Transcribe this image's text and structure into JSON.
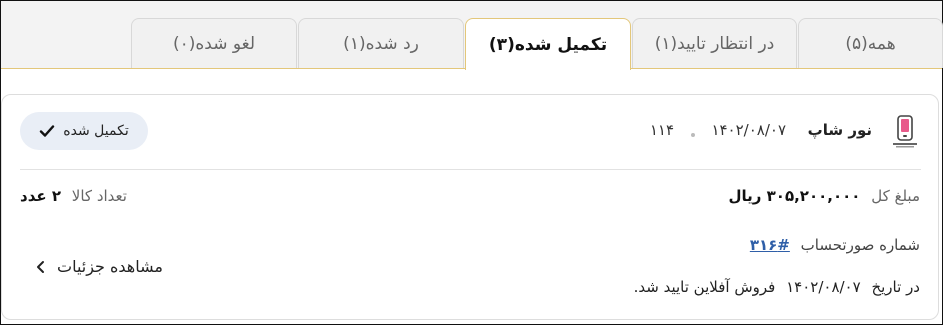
{
  "tabs": [
    {
      "label": "همه(۵)",
      "active": false
    },
    {
      "label": "در انتظار تایید(۱)",
      "active": false
    },
    {
      "label": "تکمیل شده(۳)",
      "active": true
    },
    {
      "label": "رد شده(۱)",
      "active": false
    },
    {
      "label": "لغو شده(۰)",
      "active": false
    }
  ],
  "order": {
    "shop_name": "نور شاپ",
    "date": "۱۴۰۲/۰۸/۰۷",
    "code": "۱۱۴",
    "status_label": "تکمیل شده",
    "total_label": "مبلغ کل",
    "total_value": "۳۰۵,۲۰۰,۰۰۰ ریال",
    "items_label": "تعداد کالا",
    "items_value": "۲ عدد",
    "invoice_label": "شماره صورتحساب",
    "invoice_number": "#۳۱۶",
    "confirm_prefix": "در تاریخ",
    "confirm_date": "۱۴۰۲/۰۸/۰۷",
    "confirm_suffix": "فروش آفلاین تایید شد.",
    "details_label": "مشاهده جزئیات"
  }
}
